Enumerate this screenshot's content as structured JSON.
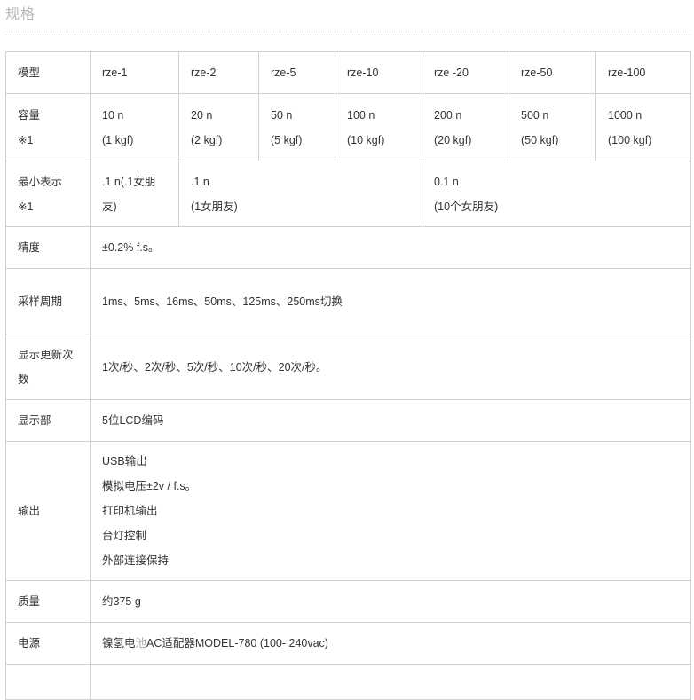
{
  "title": "规格",
  "models": {
    "label": "模型",
    "items": [
      "rze-1",
      "rze-2",
      "rze-5",
      "rze-10",
      "rze -20",
      "rze-50",
      "rze-100"
    ]
  },
  "capacity": {
    "label_line1": "容量",
    "label_line2": "※1",
    "items": [
      {
        "n": "10 n",
        "kgf": "(1 kgf)"
      },
      {
        "n": "20 n",
        "kgf": "(2 kgf)"
      },
      {
        "n": "50 n",
        "kgf": "(5 kgf)"
      },
      {
        "n": "100 n",
        "kgf": "(10 kgf)"
      },
      {
        "n": "200 n",
        "kgf": "(20 kgf)"
      },
      {
        "n": "500 n",
        "kgf": "(50 kgf)"
      },
      {
        "n": "1000 n",
        "kgf": "(100 kgf)"
      }
    ]
  },
  "min_display": {
    "label_line1": "最小表示",
    "label_line2": "※1",
    "col1_line1": ".1 n(.1女朋",
    "col1_line2": "友)",
    "col2_line1": ".1 n",
    "col2_line2": "(1女朋友)",
    "col3_line1": "0.1 n",
    "col3_line2": "(10个女朋友)"
  },
  "accuracy": {
    "label": "精度",
    "value": "±0.2% f.s。"
  },
  "sampling": {
    "label": "采样周期",
    "value": "1ms、5ms、16ms、50ms、125ms、250ms切换"
  },
  "refresh": {
    "label_line1": "显示更新次",
    "label_line2": "数",
    "value": "1次/秒、2次/秒、5次/秒、10次/秒、20次/秒。"
  },
  "display": {
    "label": "显示部",
    "value": "5位LCD编码"
  },
  "output": {
    "label": "输出",
    "lines": [
      "USB输出",
      "模拟电压±2v / f.s。",
      "打印机输出",
      "台灯控制",
      "外部连接保持"
    ]
  },
  "mass": {
    "label": "质量",
    "value": "约375 g"
  },
  "power": {
    "label": "电源",
    "value_part1": "镍氢电",
    "value_part2": "池",
    "value_part3": "AC适配器MODEL-780 (100- 240vac)"
  }
}
